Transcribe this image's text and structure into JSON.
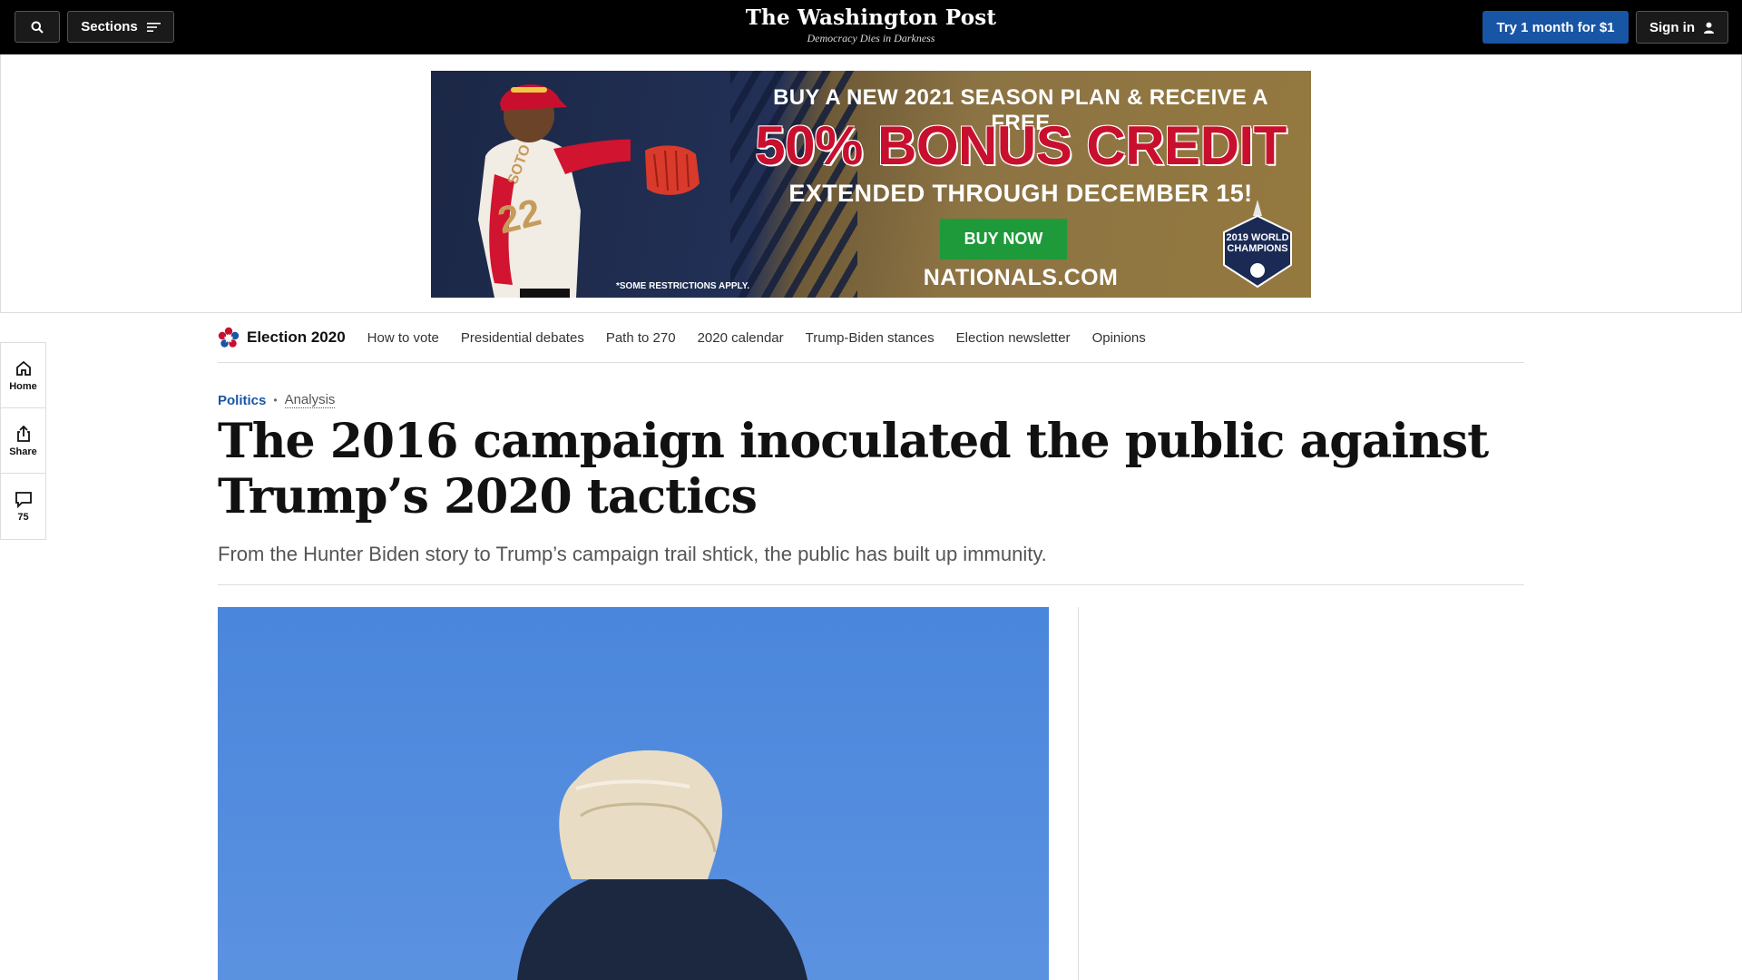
{
  "topbar": {
    "sections_label": "Sections",
    "masthead_title": "The Washington Post",
    "masthead_tagline": "Democracy Dies in Darkness",
    "trial_label": "Try 1 month for $1",
    "signin_label": "Sign in"
  },
  "ad": {
    "line1": "BUY A NEW 2021 SEASON PLAN & RECEIVE A FREE",
    "line2": "50% BONUS CREDIT",
    "line3": "EXTENDED THROUGH DECEMBER 15!",
    "cta": "BUY NOW",
    "url": "NATIONALS.COM",
    "fine_print": "*SOME RESTRICTIONS APPLY.",
    "badge": "2019 WORLD CHAMPIONS",
    "jersey_name": "SOTO",
    "jersey_number": "22"
  },
  "rail": {
    "home_label": "Home",
    "share_label": "Share",
    "comments_count": "75"
  },
  "subnav": {
    "brand_label": "Election 2020",
    "links": [
      "How to vote",
      "Presidential debates",
      "Path to 270",
      "2020 calendar",
      "Trump-Biden stances",
      "Election newsletter",
      "Opinions"
    ]
  },
  "article": {
    "section": "Politics",
    "label": "Analysis",
    "headline": "The 2016 campaign inoculated the public against Trump’s 2020 tactics",
    "subhead": "From the Hunter Biden story to Trump’s campaign trail shtick, the public has built up immunity."
  },
  "colors": {
    "topbar_bg": "#000000",
    "accent_blue": "#1955a5",
    "ad_red": "#c8102e",
    "ad_green": "#1f9a3a",
    "sky_blue": "#4a86dc"
  }
}
